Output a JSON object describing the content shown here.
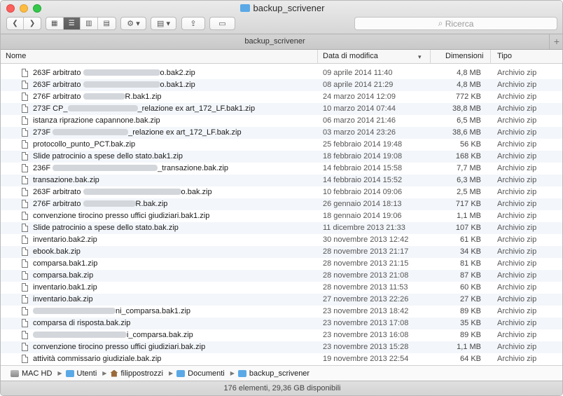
{
  "window": {
    "title": "backup_scrivener"
  },
  "toolbar": {
    "back_icon": "chevron-left-icon",
    "forward_icon": "chevron-right-icon",
    "views": [
      {
        "name": "icon-view-icon",
        "glyph": "▦"
      },
      {
        "name": "list-view-icon",
        "glyph": "☰"
      },
      {
        "name": "column-view-icon",
        "glyph": "▥"
      },
      {
        "name": "coverflow-view-icon",
        "glyph": "▤"
      }
    ],
    "action_glyph": "⚙",
    "arrange_glyph": "▤",
    "dropdown_glyph": "▾",
    "share_glyph": "⇪",
    "tag_glyph": "▭",
    "search_placeholder": "Ricerca",
    "search_glyph": "⌕"
  },
  "tab": {
    "label": "backup_scrivener",
    "add": "+"
  },
  "columns": {
    "name": "Nome",
    "date": "Data di modifica",
    "size": "Dimensioni",
    "kind": "Tipo"
  },
  "files": [
    {
      "pre": "263F arbitrato ",
      "blur": 110,
      "post": "o.bak2.zip",
      "date": "09 aprile 2014 11:40",
      "size": "4,8 MB",
      "kind": "Archivio zip"
    },
    {
      "pre": "263F arbitrato ",
      "blur": 110,
      "post": "o.bak1.zip",
      "date": "08 aprile 2014 21:29",
      "size": "4,8 MB",
      "kind": "Archivio zip"
    },
    {
      "pre": "276F arbitrato ",
      "blur": 60,
      "post": "R.bak1.zip",
      "date": "24 marzo 2014 12:09",
      "size": "772 KB",
      "kind": "Archivio zip"
    },
    {
      "pre": "273F CP_",
      "blur": 100,
      "post": "_relazione ex art_172_LF.bak1.zip",
      "date": "10 marzo 2014 07:44",
      "size": "38,8 MB",
      "kind": "Archivio zip"
    },
    {
      "pre": "istanza riprazione capannone.bak.zip",
      "blur": 0,
      "post": "",
      "date": "06 marzo 2014 21:46",
      "size": "6,5 MB",
      "kind": "Archivio zip"
    },
    {
      "pre": "273F ",
      "blur": 108,
      "post": "_relazione ex art_172_LF.bak.zip",
      "date": "03 marzo 2014 23:26",
      "size": "38,6 MB",
      "kind": "Archivio zip"
    },
    {
      "pre": "protocollo_punto_PCT.bak.zip",
      "blur": 0,
      "post": "",
      "date": "25 febbraio 2014 19:48",
      "size": "56 KB",
      "kind": "Archivio zip"
    },
    {
      "pre": "Slide patrocinio a spese dello stato.bak1.zip",
      "blur": 0,
      "post": "",
      "date": "18 febbraio 2014 19:08",
      "size": "168 KB",
      "kind": "Archivio zip"
    },
    {
      "pre": "236F ",
      "blur": 150,
      "post": "_transazione.bak.zip",
      "date": "14 febbraio 2014 15:58",
      "size": "7,7 MB",
      "kind": "Archivio zip"
    },
    {
      "pre": "transazione.bak.zip",
      "blur": 0,
      "post": "",
      "date": "14 febbraio 2014 15:52",
      "size": "6,3 MB",
      "kind": "Archivio zip"
    },
    {
      "pre": "263F arbitrato ",
      "blur": 140,
      "post": "o.bak.zip",
      "date": "10 febbraio 2014 09:06",
      "size": "2,5 MB",
      "kind": "Archivio zip"
    },
    {
      "pre": "276F arbitrato ",
      "blur": 75,
      "post": "R.bak.zip",
      "date": "26 gennaio 2014 18:13",
      "size": "717 KB",
      "kind": "Archivio zip"
    },
    {
      "pre": "convenzione tirocino presso uffici giudiziari.bak1.zip",
      "blur": 0,
      "post": "",
      "date": "18 gennaio 2014 19:06",
      "size": "1,1 MB",
      "kind": "Archivio zip"
    },
    {
      "pre": "Slide patrocinio a spese dello stato.bak.zip",
      "blur": 0,
      "post": "",
      "date": "11 dicembre 2013 21:33",
      "size": "107 KB",
      "kind": "Archivio zip"
    },
    {
      "pre": "inventario.bak2.zip",
      "blur": 0,
      "post": "",
      "date": "30 novembre 2013 12:42",
      "size": "61 KB",
      "kind": "Archivio zip"
    },
    {
      "pre": "ebook.bak.zip",
      "blur": 0,
      "post": "",
      "date": "28 novembre 2013 21:17",
      "size": "34 KB",
      "kind": "Archivio zip"
    },
    {
      "pre": "comparsa.bak1.zip",
      "blur": 0,
      "post": "",
      "date": "28 novembre 2013 21:15",
      "size": "81 KB",
      "kind": "Archivio zip"
    },
    {
      "pre": "comparsa.bak.zip",
      "blur": 0,
      "post": "",
      "date": "28 novembre 2013 21:08",
      "size": "87 KB",
      "kind": "Archivio zip"
    },
    {
      "pre": "inventario.bak1.zip",
      "blur": 0,
      "post": "",
      "date": "28 novembre 2013 11:53",
      "size": "60 KB",
      "kind": "Archivio zip"
    },
    {
      "pre": "inventario.bak.zip",
      "blur": 0,
      "post": "",
      "date": "27 novembre 2013 22:26",
      "size": "27 KB",
      "kind": "Archivio zip"
    },
    {
      "pre": "",
      "blur": 118,
      "post": "ni_comparsa.bak1.zip",
      "date": "23 novembre 2013 18:42",
      "size": "89 KB",
      "kind": "Archivio zip"
    },
    {
      "pre": "comparsa di risposta.bak.zip",
      "blur": 0,
      "post": "",
      "date": "23 novembre 2013 17:08",
      "size": "35 KB",
      "kind": "Archivio zip"
    },
    {
      "pre": "",
      "blur": 134,
      "post": "i_comparsa.bak.zip",
      "date": "23 novembre 2013 16:08",
      "size": "89 KB",
      "kind": "Archivio zip"
    },
    {
      "pre": "convenzione tirocino presso uffici giudiziari.bak.zip",
      "blur": 0,
      "post": "",
      "date": "23 novembre 2013 15:28",
      "size": "1,1 MB",
      "kind": "Archivio zip"
    },
    {
      "pre": "attività commissario giudiziale.bak.zip",
      "blur": 0,
      "post": "",
      "date": "19 novembre 2013 22:54",
      "size": "64 KB",
      "kind": "Archivio zip"
    }
  ],
  "path": [
    {
      "label": "MAC HD",
      "icon": "hd"
    },
    {
      "label": "Utenti",
      "icon": "fold"
    },
    {
      "label": "filippostrozzi",
      "icon": "home"
    },
    {
      "label": "Documenti",
      "icon": "fold"
    },
    {
      "label": "backup_scrivener",
      "icon": "fold"
    }
  ],
  "path_sep": "▶",
  "status": "176 elementi, 29,36 GB disponibili"
}
